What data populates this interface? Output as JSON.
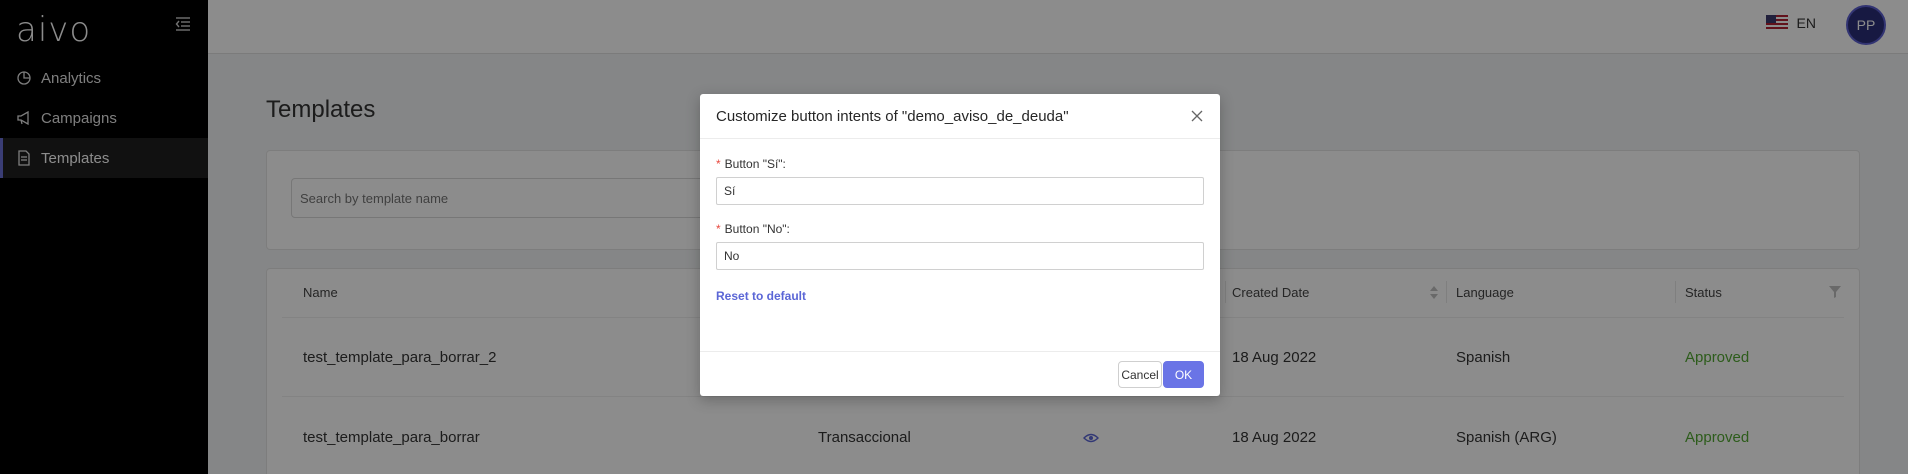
{
  "sidebar": {
    "logo": "aivo",
    "items": [
      {
        "label": "Analytics",
        "icon": "analytics-icon"
      },
      {
        "label": "Campaigns",
        "icon": "megaphone-icon"
      },
      {
        "label": "Templates",
        "icon": "document-icon",
        "active": true
      }
    ]
  },
  "topbar": {
    "language": "EN",
    "avatar_initials": "PP"
  },
  "main": {
    "title": "Templates",
    "search_placeholder": "Search by template name",
    "table": {
      "columns": [
        "Name",
        "Created Date",
        "Language",
        "Status"
      ],
      "rows": [
        {
          "name": "test_template_para_borrar_2",
          "category": "",
          "created": "18 Aug 2022",
          "language": "Spanish",
          "status": "Approved"
        },
        {
          "name": "test_template_para_borrar",
          "category": "Transaccional",
          "created": "18 Aug 2022",
          "language": "Spanish (ARG)",
          "status": "Approved"
        }
      ]
    }
  },
  "modal": {
    "title": "Customize button intents of \"demo_aviso_de_deuda\"",
    "field_si_label": "Button \"Sí\":",
    "field_si_value": "Sí",
    "field_no_label": "Button \"No\":",
    "field_no_value": "No",
    "required_mark": "*",
    "reset_label": "Reset to default",
    "cancel_label": "Cancel",
    "ok_label": "OK"
  },
  "colors": {
    "accent": "#6a74e6",
    "status_approved": "#52a832",
    "sidebar_bg": "#000000"
  }
}
